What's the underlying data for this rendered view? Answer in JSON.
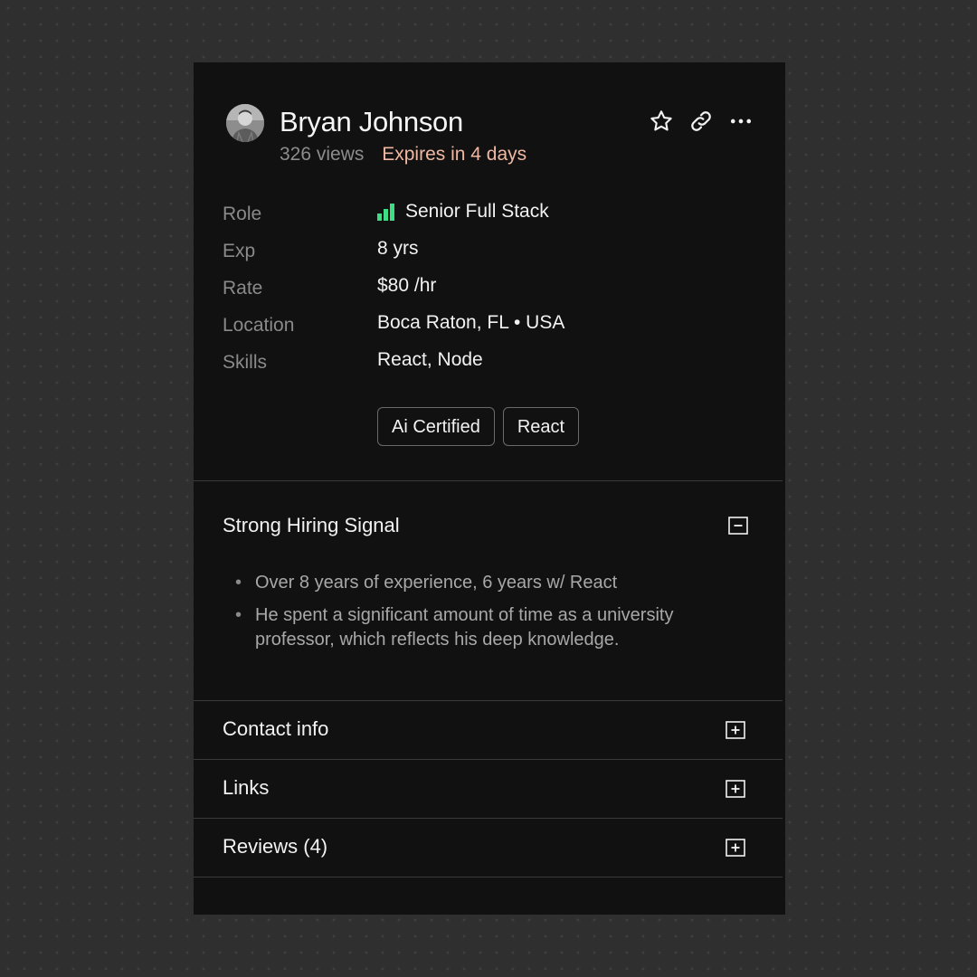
{
  "profile": {
    "name": "Bryan Johnson",
    "views": "326 views",
    "expires": "Expires in 4 days"
  },
  "actions": [
    {
      "icon": "star-icon"
    },
    {
      "icon": "link-icon"
    },
    {
      "icon": "more-icon"
    }
  ],
  "details": [
    {
      "label": "Role",
      "value": "Senior Full Stack",
      "level_icon": "signal-bars-icon",
      "level": "3 of 3"
    },
    {
      "label": "Exp",
      "value": "8 yrs"
    },
    {
      "label": "Rate",
      "value": "$80 /hr"
    },
    {
      "label": "Location",
      "value": "Boca Raton, FL • USA"
    },
    {
      "label": "Skills",
      "value": "React, Node"
    }
  ],
  "tags": [
    "Ai Certified",
    "React"
  ],
  "hiring_signal": {
    "title": "Strong Hiring Signal",
    "expanded": true,
    "bullets": [
      "Over 8 years of experience, 6 years w/ React",
      "He spent a significant amount of time as a university professor, which reflects his deep knowledge."
    ]
  },
  "sections": [
    {
      "title": "Contact info",
      "expanded": false
    },
    {
      "title": "Links",
      "expanded": false
    },
    {
      "title": "Reviews (4)",
      "expanded": false
    }
  ],
  "colors": {
    "background": "#2f2f2f",
    "card": "#111111",
    "accent_expires": "#f0b8a2",
    "signal_green": "#3fdc86"
  }
}
